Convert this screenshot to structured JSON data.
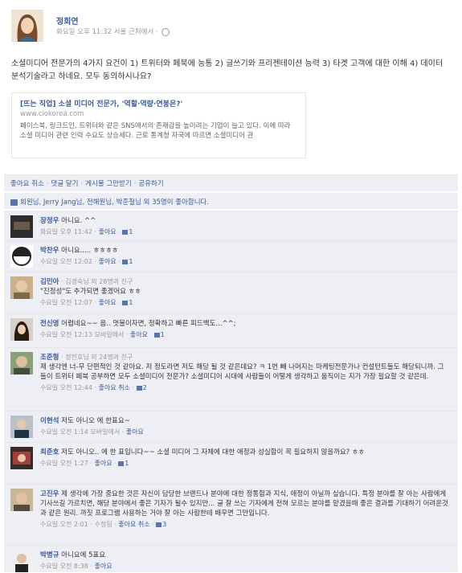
{
  "post": {
    "author": "정희연",
    "meta": "화요일 오후 11:32 서울 근처에서 ·",
    "text": "소셜미디어 전문가의 4가지 요건이 1) 트위터와 페북에 능통 2) 글쓰기와 프리젠테이션 능력 3) 타겟 고객에 대한 이해 4) 데이터 분석기술라고 하네요. 모두 동의하시나요?",
    "link": {
      "title": "[뜨는 직업] 소셜 미디어 전문가, '역할·역량·연봉은?'",
      "domain": "www.ciokorea.com",
      "description": "페이스북, 링크드인, 트위터와 같은 SNS에서의 존재감을 높이려는 기업이 늘고 있다. 이에 따라 소셜 미디어 관련 인력 수요도 상승세다. 근로 통계청 자국에 따르면 소셜미디어 관"
    }
  },
  "actions": {
    "unlike": "좋아요 취소",
    "comment": "댓글 달기",
    "unfollow": "게시물 그만받기",
    "share": "공유하기"
  },
  "likes_text": "회원님, Jerry Jang님, 전해원님, 박준철님 외 35명이 좋아합니다.",
  "comments": [
    {
      "name": "장정우",
      "extra": "",
      "text": "아니요. ^^",
      "meta": "화요일 오후 11:42 ·",
      "like": "좋아요",
      "count": "1"
    },
    {
      "name": "박찬우",
      "extra": "",
      "text": "아니요..... ㅎㅎㅎㅎ",
      "meta": "수요일 오전 12:02 ·",
      "like": "좋아요",
      "count": "1"
    },
    {
      "name": "김민아",
      "extra": "· 김경숙님 외 28명과 친구",
      "text": "\"진정성\"도 추가되면 좋겠어요 ㅎㅎ",
      "meta": "수요일 오전 12:07 ·",
      "like": "좋아요",
      "count": "1"
    },
    {
      "name": "전신영",
      "extra": "",
      "text": "어렵네요~~ 음.. 멋불이자면, 정확하고 빠른 피드백도...^^;",
      "meta": "수요일 오전 12:13 모바일에서 ·",
      "like": "좋아요",
      "count": "1"
    },
    {
      "name": "조준형",
      "extra": "· 정진호님 외 24명과 친구",
      "text": "제 생각엔 너-무 단편적인 것 같아요. 저 정도라면 저도 해당 될 것 같은데요? ㅋ 1번 빼 나머지는 마케팅전문가나 컨설턴트들도 해당되니까. 그들이 트위터 페북 공부하면 모두 소셜미디어 전문가? 소셜미디어 시대에 사람들이 어떻게 생각하고 움직이는 지가 가장 필요할 것 같은데.",
      "meta": "수요일 오전 12:44 ·",
      "like": "좋아요 취소",
      "count": "2"
    },
    {
      "name": "이현석",
      "extra": "",
      "text": "저도 아니오 에 한표요~",
      "meta": "수요일 오전 1:14 모바일에서 ·",
      "like": "좋아요",
      "count": ""
    },
    {
      "name": "최준호",
      "extra": "",
      "text": "저도 아니오.. 에 한 표입니다~~ 소셜 미디어 그 자체에 대한 애정과 성실함이 꼭 필요하지 않을까요? ㅎㅎ",
      "meta": "수요일 오전 1:27 ·",
      "like": "좋아요",
      "count": "1"
    },
    {
      "name": "고진우",
      "extra": "",
      "text": "제 생각에 가장 중요한 것은 자신이 담당한 브랜드나 분야에 대한 정통함과 지식, 애정이 아닐까 싶습니다. 특정 분야를 잘 아는 사람에게 기사쓰길 가르치면, 해당 분야에서 좋은 기자가 될수 있지만... 글 잘 쓰는 기자에게 전혀 모르는 분야를 맡겼을때 좋은 결과를 기대하기 어려운것과 같은 원리. 까짓 프로그램 사용하는 거야 잘 아는 사람한테 배우면 그만입니다.",
      "meta": "수요일 오전 2:01 · 수정됨 ·",
      "like": "좋아요 취소",
      "count": "3"
    },
    {
      "name": "박병규",
      "extra": "",
      "text": "아니요에 5표요",
      "meta": "수요일 오전 8:38 ·",
      "like": "좋아요",
      "count": ""
    }
  ]
}
